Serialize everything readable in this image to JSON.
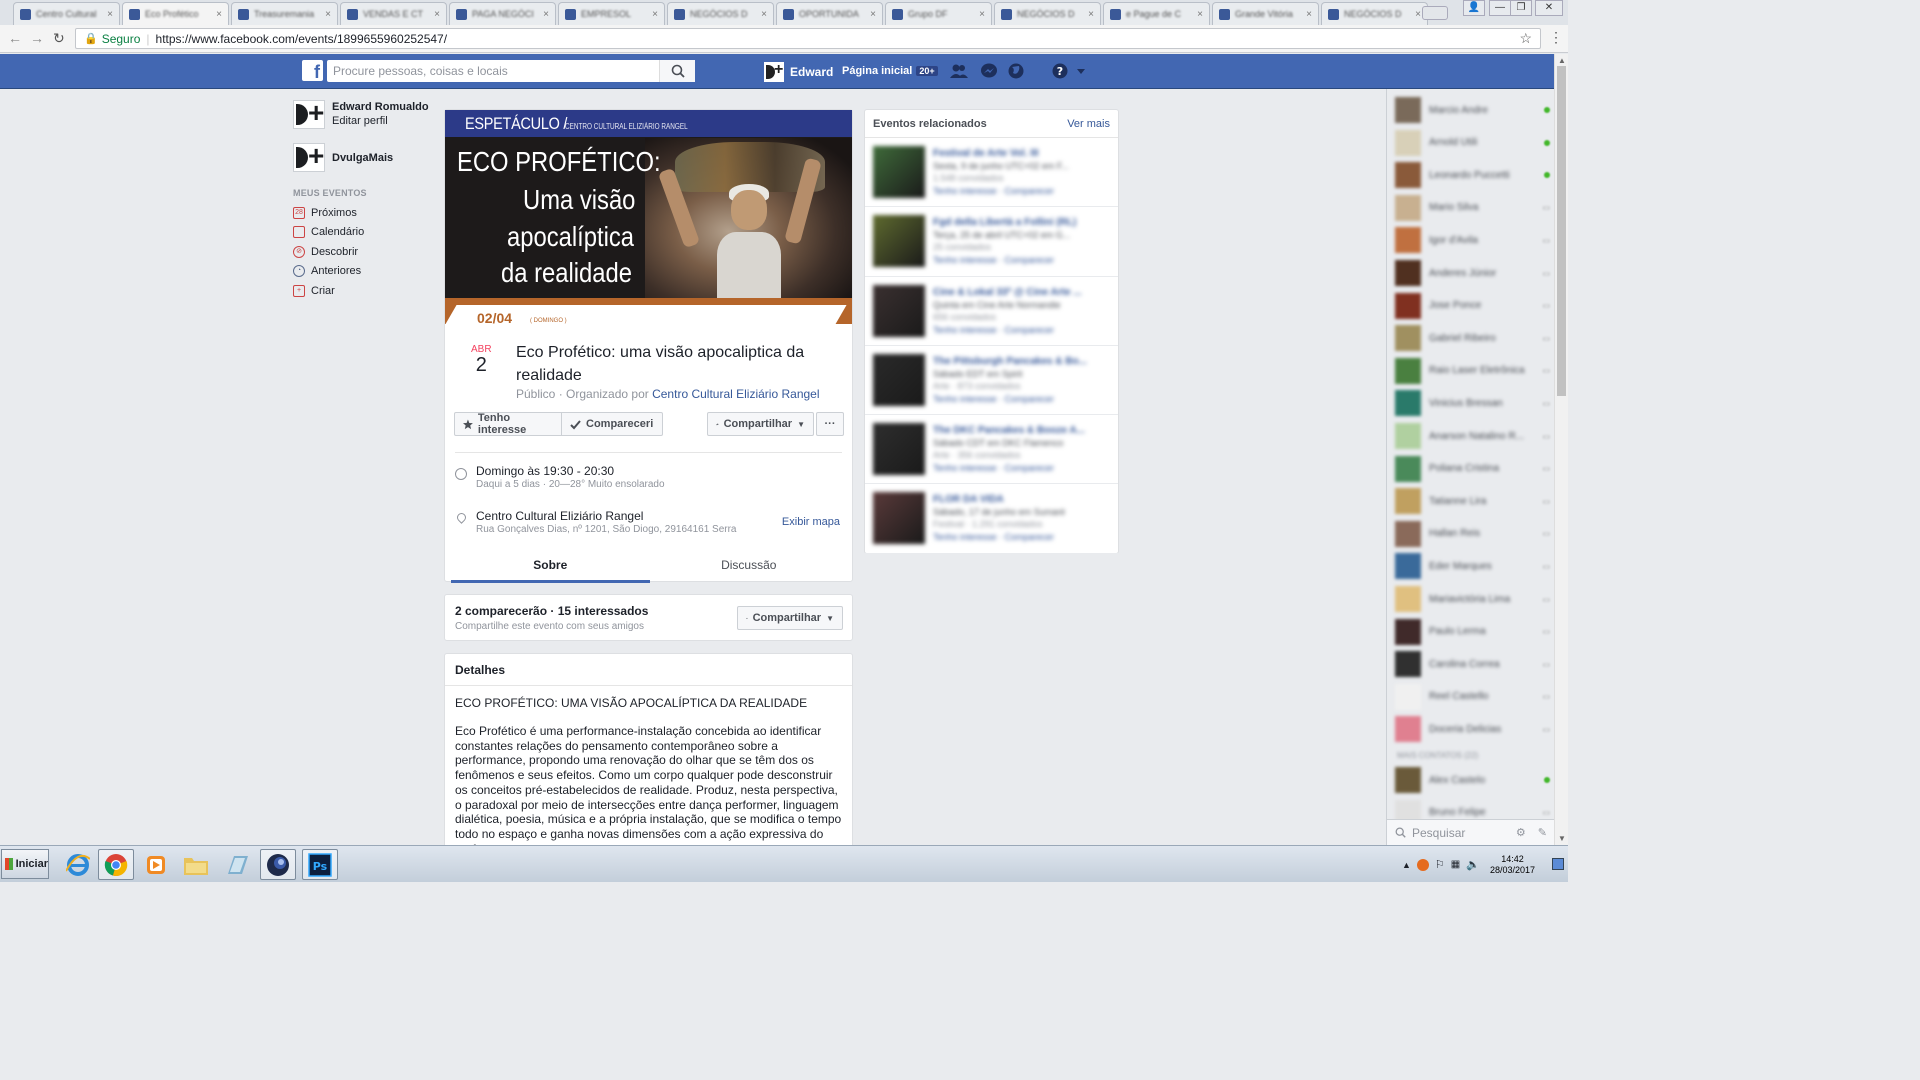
{
  "browser": {
    "tabs": [
      {
        "title": "Centro Cultural"
      },
      {
        "title": "Eco Profético"
      },
      {
        "title": "Treasuremania"
      },
      {
        "title": "VENDAS E CT"
      },
      {
        "title": "PAGA NEGÓCI"
      },
      {
        "title": "EMPRESOL"
      },
      {
        "title": "NEGÓCIOS D"
      },
      {
        "title": "OPORTUNIDA"
      },
      {
        "title": "Grupo DF"
      },
      {
        "title": "NEGÓCIOS D"
      },
      {
        "title": "e Pague de C"
      },
      {
        "title": "Grande Vitória"
      },
      {
        "title": "NEGÓCIOS D"
      }
    ],
    "secure_label": "Seguro",
    "url": "https://www.facebook.com/events/1899655960252547/"
  },
  "fb_header": {
    "logo": "f",
    "search_placeholder": "Procure pessoas, coisas e locais",
    "user_name": "Edward",
    "home_label": "Página inicial",
    "home_badge": "20+"
  },
  "left_nav": {
    "profile_name": "Edward Romualdo",
    "edit_profile": "Editar perfil",
    "page_name": "DvulgaMais",
    "section_title": "MEUS EVENTOS",
    "items": [
      {
        "label": "Próximos",
        "icon": "calendar-28-icon"
      },
      {
        "label": "Calendário",
        "icon": "calendar-icon"
      },
      {
        "label": "Descobrir",
        "icon": "compass-icon"
      },
      {
        "label": "Anteriores",
        "icon": "clock-icon"
      },
      {
        "label": "Criar",
        "icon": "plus-icon"
      }
    ]
  },
  "event": {
    "cover": {
      "category": "ESPETÁCULO /",
      "organizer_small": "CENTRO CULTURAL ELIZIÁRIO RANGEL",
      "title_lines": [
        "ECO PROFÉTICO:",
        "Uma visão",
        "apocalíptica",
        "da realidade"
      ],
      "date": "02/04",
      "date_sub": "( DOMINGO )"
    },
    "month": "ABR",
    "day": "2",
    "title": "Eco Profético: uma visão apocaliptica da realidade",
    "privacy": "Público",
    "organized_by": "· Organizado por",
    "organizer": "Centro Cultural Eliziário Rangel",
    "buttons": {
      "interested": "Tenho interesse",
      "attended": "Compareceri",
      "share": "Compartilhar",
      "more": "···"
    },
    "time_main": "Domingo às 19:30 - 20:30",
    "time_sub": "Daqui a 5 dias · 20—28° Muito ensolarado",
    "place_main": "Centro Cultural Eliziário Rangel",
    "place_sub": "Rua Gonçalves Dias, nº 1201, São Diogo, 29164161 Serra",
    "map_link": "Exibir mapa",
    "tabs": [
      "Sobre",
      "Discussão"
    ]
  },
  "attendance": {
    "summary": "2 comparecerão · 15 interessados",
    "sub": "Compartilhe este evento com seus amigos",
    "share": "Compartilhar"
  },
  "details": {
    "heading": "Detalhes",
    "title": "ECO PROFÉTICO: UMA VISÃO APOCALÍPTICA DA REALIDADE",
    "body": "Eco Profético é uma performance-instalação concebida ao identificar constantes relações do pensamento contemporâneo sobre a performance, propondo uma renovação do olhar que se têm dos os fenômenos e seus efeitos. Como um corpo qualquer pode desconstruir os conceitos pré-estabelecidos de realidade. Produz, nesta perspectiva, o paradoxal por meio de intersecções entre dança performer, linguagem dialética, poesia, música e a própria instalação, que se modifica o tempo todo no espaço e ganha novas dimensões com a ação expressiva do performer."
  },
  "related": {
    "heading": "Eventos relacionados",
    "more": "Ver mais",
    "items": [
      {
        "title": "Festival de Arte Vol. III",
        "line2": "Sexta, 9 de junho UTC+02 em F...",
        "line3": "1.548 convidados",
        "actions": "Tenho interesse · Comparecer",
        "color": "#3f6b3a"
      },
      {
        "title": "Fgd della Libertà a Follini (RL)",
        "line2": "Terça, 25 de abril UTC+02 em G...",
        "line3": "25 convidados",
        "actions": "Tenho interesse · Comparecer",
        "color": "#5f6b2f"
      },
      {
        "title": "Cine & Lokal 33ª @ Cine Arte ...",
        "line2": "Quinta em Cine Arte Normandie",
        "line3": "656 convidados",
        "actions": "Tenho interesse · Comparecer",
        "color": "#3a3030"
      },
      {
        "title": "The Pittsburgh Pancakes & Bo...",
        "line2": "Sábado EDT em Spirit",
        "line3": "Arte · 873 convidados",
        "actions": "Tenho interesse · Comparecer",
        "color": "#2a2a2a"
      },
      {
        "title": "The DKC Pancakes & Booze A...",
        "line2": "Sábado CDT em DKC Flamenco",
        "line3": "Arte · 356 convidados",
        "actions": "Tenho interesse · Comparecer",
        "color": "#2e2e2e"
      },
      {
        "title": "FLOR DA VIDA",
        "line2": "Sábado, 17 de junho em Sumaré",
        "line3": "Festival · 1.291 convidados",
        "actions": "Tenho interesse · Comparecer",
        "color": "#5a3a3a"
      }
    ]
  },
  "chat": {
    "contacts": [
      {
        "name": "Marcio Andre",
        "online": true,
        "color": "#7a6a5a"
      },
      {
        "name": "Arnold Utili",
        "online": true,
        "color": "#d8d0b8"
      },
      {
        "name": "Leonardo Puccetti",
        "online": true,
        "color": "#8a5a3a"
      },
      {
        "name": "Mario Silva",
        "online": false,
        "color": "#c8b090"
      },
      {
        "name": "Igor d'Avila",
        "online": false,
        "color": "#c07040"
      },
      {
        "name": "Anderes Júnior",
        "online": false,
        "color": "#503020"
      },
      {
        "name": "Jose Ponce",
        "online": false,
        "color": "#803020"
      },
      {
        "name": "Gabriel Ribeiro",
        "online": false,
        "color": "#a09060"
      },
      {
        "name": "Raio Laser Eletrônica",
        "online": false,
        "color": "#4a8040"
      },
      {
        "name": "Vinicius Bressan",
        "online": false,
        "color": "#2a7a6a"
      },
      {
        "name": "Anarson Natalino R...",
        "online": false,
        "color": "#b0d0a0"
      },
      {
        "name": "Poliana Cristina",
        "online": false,
        "color": "#4a8a5a"
      },
      {
        "name": "Tatianne Lira",
        "online": false,
        "color": "#c0a060"
      },
      {
        "name": "Hallan Reis",
        "online": false,
        "color": "#8a6a5a"
      },
      {
        "name": "Eder Marques",
        "online": false,
        "color": "#3a6a9a"
      },
      {
        "name": "Mariavictória Lima",
        "online": false,
        "color": "#e0c080"
      },
      {
        "name": "Paulo Lerma",
        "online": false,
        "color": "#402a2a"
      },
      {
        "name": "Carolina Correa",
        "online": false,
        "color": "#303030"
      },
      {
        "name": "Reel Castello",
        "online": false,
        "color": "#f0f0f0"
      },
      {
        "name": "Doceria Delicias",
        "online": false,
        "color": "#e08090"
      }
    ],
    "more_contacts_label": "MAIS CONTATOS (22)",
    "more_contacts": [
      {
        "name": "Alex Castelo",
        "online": true,
        "color": "#6a5a3a"
      },
      {
        "name": "Bruno Felipe",
        "online": false,
        "color": "#e0e0e0"
      }
    ],
    "search_placeholder": "Pesquisar"
  },
  "taskbar": {
    "start_label": "Iniciar",
    "apps": [
      "ie-icon",
      "chrome-icon",
      "media-player-icon",
      "folder-icon",
      "app-icon",
      "cinema4d-icon",
      "photoshop-icon"
    ],
    "time": "14:42",
    "date": "28/03/2017"
  }
}
